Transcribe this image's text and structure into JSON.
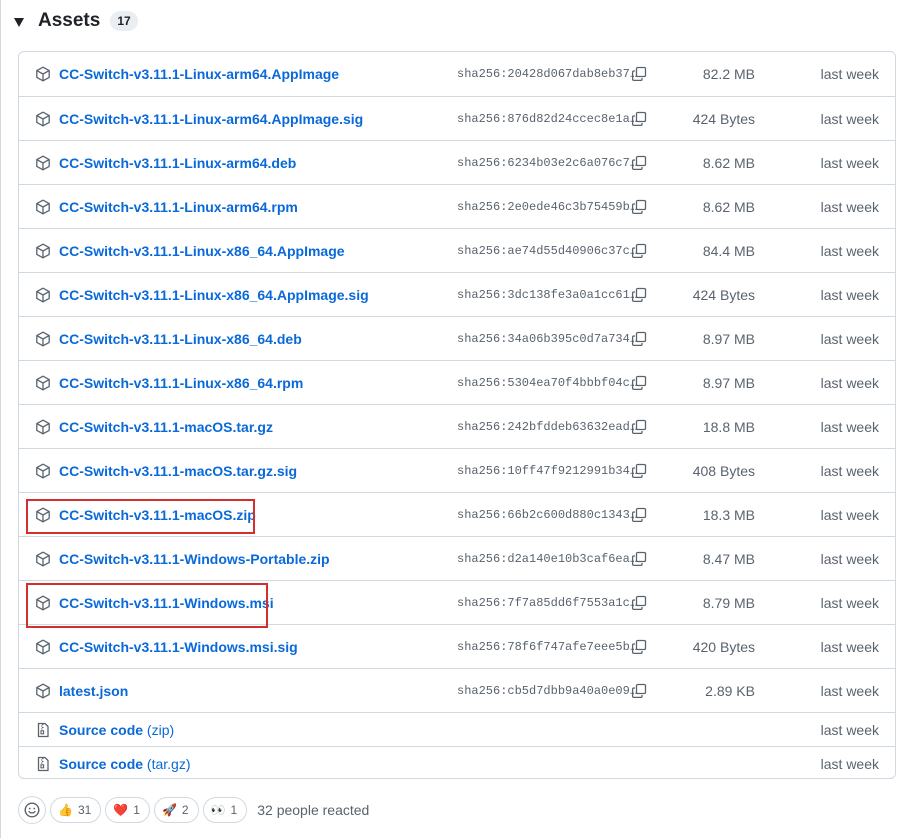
{
  "header": {
    "title": "Assets",
    "count": "17"
  },
  "assets": [
    {
      "name": "CC-Switch-v3.11.1-Linux-arm64.AppImage",
      "sha": "sha256:20428d067dab8eb37…",
      "size": "82.2 MB",
      "date": "last week"
    },
    {
      "name": "CC-Switch-v3.11.1-Linux-arm64.AppImage.sig",
      "sha": "sha256:876d82d24ccec8e1a…",
      "size": "424 Bytes",
      "date": "last week"
    },
    {
      "name": "CC-Switch-v3.11.1-Linux-arm64.deb",
      "sha": "sha256:6234b03e2c6a076c7…",
      "size": "8.62 MB",
      "date": "last week"
    },
    {
      "name": "CC-Switch-v3.11.1-Linux-arm64.rpm",
      "sha": "sha256:2e0ede46c3b75459b…",
      "size": "8.62 MB",
      "date": "last week"
    },
    {
      "name": "CC-Switch-v3.11.1-Linux-x86_64.AppImage",
      "sha": "sha256:ae74d55d40906c37c…",
      "size": "84.4 MB",
      "date": "last week"
    },
    {
      "name": "CC-Switch-v3.11.1-Linux-x86_64.AppImage.sig",
      "sha": "sha256:3dc138fe3a0a1cc61…",
      "size": "424 Bytes",
      "date": "last week"
    },
    {
      "name": "CC-Switch-v3.11.1-Linux-x86_64.deb",
      "sha": "sha256:34a06b395c0d7a734…",
      "size": "8.97 MB",
      "date": "last week"
    },
    {
      "name": "CC-Switch-v3.11.1-Linux-x86_64.rpm",
      "sha": "sha256:5304ea70f4bbbf04c…",
      "size": "8.97 MB",
      "date": "last week"
    },
    {
      "name": "CC-Switch-v3.11.1-macOS.tar.gz",
      "sha": "sha256:242bfddeb63632ead…",
      "size": "18.8 MB",
      "date": "last week"
    },
    {
      "name": "CC-Switch-v3.11.1-macOS.tar.gz.sig",
      "sha": "sha256:10ff47f9212991b34…",
      "size": "408 Bytes",
      "date": "last week"
    },
    {
      "name": "CC-Switch-v3.11.1-macOS.zip",
      "sha": "sha256:66b2c600d880c1343…",
      "size": "18.3 MB",
      "date": "last week"
    },
    {
      "name": "CC-Switch-v3.11.1-Windows-Portable.zip",
      "sha": "sha256:d2a140e10b3caf6ea…",
      "size": "8.47 MB",
      "date": "last week"
    },
    {
      "name": "CC-Switch-v3.11.1-Windows.msi",
      "sha": "sha256:7f7a85dd6f7553a1c…",
      "size": "8.79 MB",
      "date": "last week"
    },
    {
      "name": "CC-Switch-v3.11.1-Windows.msi.sig",
      "sha": "sha256:78f6f747afe7eee5b…",
      "size": "420 Bytes",
      "date": "last week"
    },
    {
      "name": "latest.json",
      "sha": "sha256:cb5d7dbb9a40a0e09…",
      "size": "2.89 KB",
      "date": "last week"
    }
  ],
  "sources": [
    {
      "label": "Source code",
      "suffix": "(zip)",
      "date": "last week"
    },
    {
      "label": "Source code",
      "suffix": "(tar.gz)",
      "date": "last week"
    }
  ],
  "reactions": {
    "items": [
      {
        "emoji": "👍",
        "count": "31"
      },
      {
        "emoji": "❤️",
        "count": "1"
      },
      {
        "emoji": "🚀",
        "count": "2"
      },
      {
        "emoji": "👀",
        "count": "1"
      }
    ],
    "summary": "32 people reacted"
  },
  "icons": {
    "asset": "package-icon",
    "source": "file-zip-icon",
    "copy": "copy-icon",
    "caret": "triangle-down-icon",
    "react": "smiley-icon"
  },
  "colors": {
    "link": "#0969da",
    "muted": "#59636e",
    "border": "#d1d9e0",
    "highlight": "#d32f2f"
  }
}
